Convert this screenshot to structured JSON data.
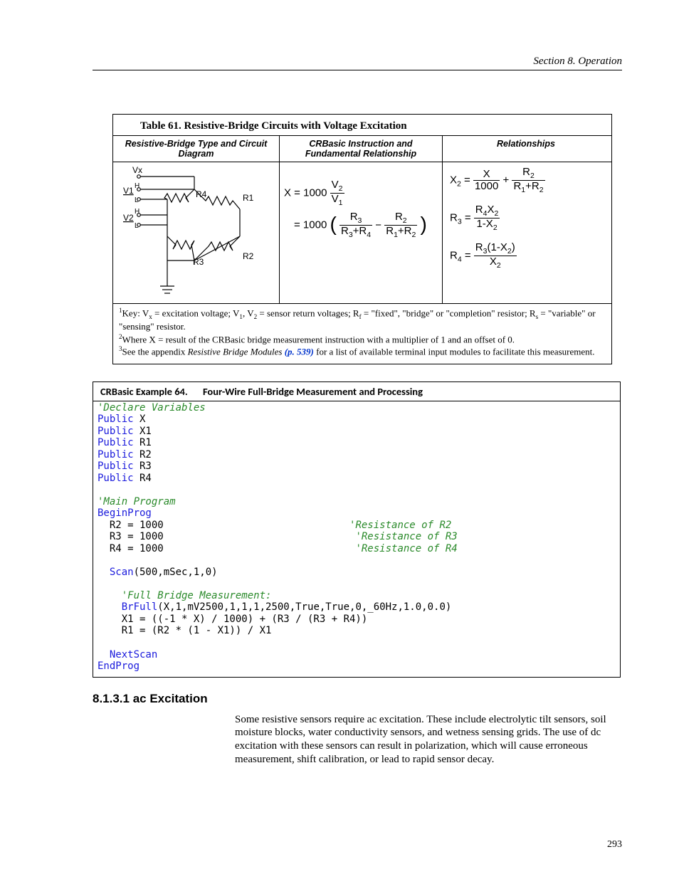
{
  "header": {
    "section": "Section 8.  Operation"
  },
  "table61": {
    "title": "Table 61. Resistive-Bridge Circuits with Voltage Excitation",
    "col1": "Resistive-Bridge Type and Circuit Diagram",
    "col2": "CRBasic Instruction and Fundamental Relationship",
    "col3": "Relationships",
    "circuit": {
      "vx": "Vx",
      "v1": "V1",
      "v2": "V2",
      "h1": "H",
      "l1": "L",
      "h2": "H",
      "l2": "L",
      "r1": "R1",
      "r2": "R2",
      "r3": "R3",
      "r4": "R4"
    },
    "instr": {
      "x_eq": "X",
      "eq_sign_1": " = 1000 ",
      "v2": "V",
      "v2_sub": "2",
      "v1": "V",
      "v1_sub": "1",
      "line2_prefix": "= 1000",
      "r3a": "R",
      "r3a_sub": "3",
      "r4a": "R",
      "r4a_sub": "4",
      "r2a": "R",
      "r2a_sub": "2",
      "r1a": "R",
      "r1a_sub": "1",
      "plus_1": "+",
      "plus_2": "+",
      "minus": "−"
    },
    "rel": {
      "x2": "X",
      "x2_sub": "2",
      "eq": "=",
      "x_num": "X",
      "thousand": "1000",
      "plus": "+",
      "r2n": "R",
      "r2n_sub": "2",
      "r1d": "R",
      "r1d_sub": "1",
      "r2d": "R",
      "r2d_sub": "2",
      "plus2": "+",
      "r3": "R",
      "r3_sub": "3",
      "r4": "R",
      "r4_sub": "4",
      "x2b": "X",
      "x2b_sub": "2",
      "one": "1",
      "one_minus_x2": "1-X",
      "x2c_sub": "2",
      "r4b": "R",
      "r4b_sub": "4",
      "r3b": "R",
      "r3b_sub": "3",
      "one2": "1-",
      "x2d": "X",
      "x2d_sub": "2",
      "x2e": "X",
      "x2e_sub": "2"
    },
    "notes": {
      "n1_pre": "Key: V",
      "n1_vx_sub": "x",
      "n1_a": " = excitation voltage; V",
      "n1_v1_sub": "1",
      "n1_b": ", V",
      "n1_v2_sub": "2",
      "n1_c": " = sensor return voltages; R",
      "n1_rf_sub": "f",
      "n1_d": " = \"fixed\", \"bridge\" or \"completion\" resistor; R",
      "n1_rs_sub": "s",
      "n1_e": " = \"variable\" or \"sensing\" resistor.",
      "n2": "Where X = result of the CRBasic bridge measurement instruction with a multiplier of 1 and an offset of 0.",
      "n3_a": "See the appendix ",
      "n3_b": "Resistive Bridge Modules ",
      "n3_link": "(p. 539)",
      "n3_c": " for a list of available terminal input modules to facilitate this measurement."
    }
  },
  "example64": {
    "label": "CRBasic Example 64.",
    "title": "Four-Wire Full-Bridge Measurement and Processing",
    "c_decl": "'Declare Variables",
    "pub": "Public",
    "vars": {
      "x": " X",
      "x1": " X1",
      "r1": " R1",
      "r2": " R2",
      "r3": " R3",
      "r4": " R4"
    },
    "c_main": "'Main Program",
    "begin": "BeginProg",
    "r2line": "  R2 = 1000",
    "r2c": "'Resistance of R2",
    "r3line": "  R3 = 1000",
    "r3c": "'Resistance of R3",
    "r4line": "  R4 = 1000",
    "r4c": "'Resistance of R4",
    "scan": "Scan",
    "scanargs": "(500,mSec,1,0)",
    "c_fb": "'Full Bridge Measurement:",
    "brfull": "BrFull",
    "brfullargs": "(X,1,mV2500,1,1,1,2500,True,True,0,_60Hz,1.0,0.0)",
    "x1line": "    X1 = ((-1 * X) / 1000) + (R3 / (R3 + R4))",
    "r1line": "    R1 = (R2 * (1 - X1)) / X1",
    "nextscan": "NextScan",
    "endprog": "EndProg"
  },
  "section": {
    "heading": "8.1.3.1 ac Excitation",
    "body": "Some resistive sensors require ac excitation. These include electrolytic tilt sensors, soil moisture blocks, water conductivity sensors, and wetness sensing grids. The use of dc excitation with these sensors can result in polarization, which will cause erroneous measurement, shift calibration, or lead to rapid sensor decay."
  },
  "page_number": "293"
}
